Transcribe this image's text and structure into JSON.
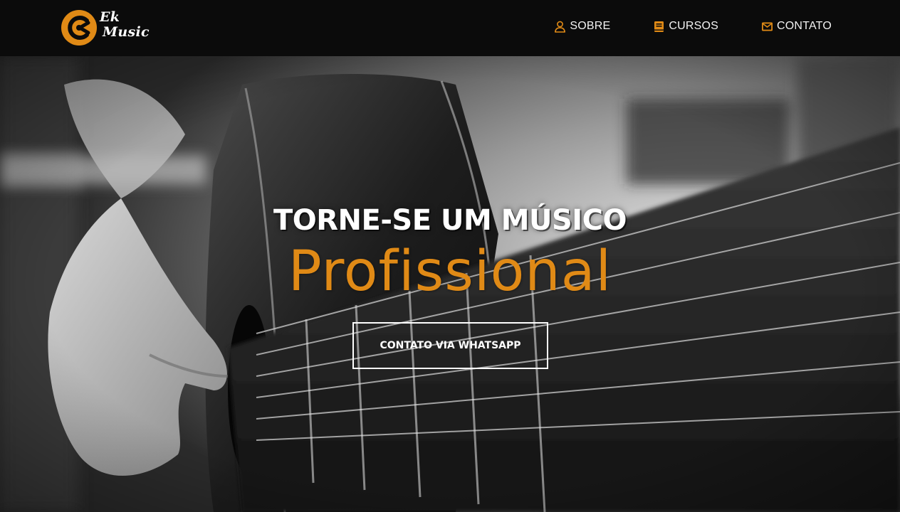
{
  "colors": {
    "accent": "#E08A16",
    "navbar_bg": "#0B0B0B",
    "text": "#FFFFFF"
  },
  "brand": {
    "line1": "Ek",
    "line2": "Music",
    "logo_icon": "ek-music-logo"
  },
  "nav": {
    "items": [
      {
        "label": "SOBRE",
        "icon": "user-icon"
      },
      {
        "label": "CURSOS",
        "icon": "book-icon"
      },
      {
        "label": "CONTATO",
        "icon": "envelope-icon"
      }
    ]
  },
  "hero": {
    "background": "black-and-white photo of hands playing an acoustic guitar",
    "title": "TORNE-SE UM MÚSICO",
    "highlight": "Profissional",
    "cta_label": "CONTATO VIA WHATSAPP"
  }
}
